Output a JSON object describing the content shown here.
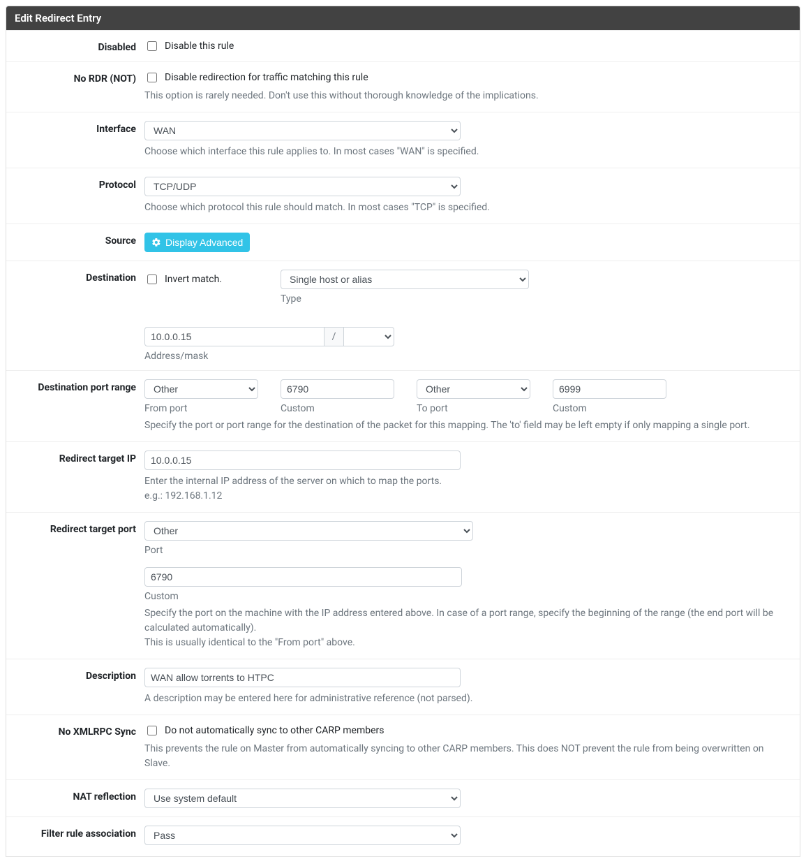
{
  "panel": {
    "title": "Edit Redirect Entry"
  },
  "disabled": {
    "label": "Disabled",
    "checkbox_label": "Disable this rule"
  },
  "nordr": {
    "label": "No RDR (NOT)",
    "checkbox_label": "Disable redirection for traffic matching this rule",
    "help": "This option is rarely needed. Don't use this without thorough knowledge of the implications."
  },
  "interface": {
    "label": "Interface",
    "value": "WAN",
    "help": "Choose which interface this rule applies to. In most cases \"WAN\" is specified."
  },
  "protocol": {
    "label": "Protocol",
    "value": "TCP/UDP",
    "help": "Choose which protocol this rule should match. In most cases \"TCP\" is specified."
  },
  "source": {
    "label": "Source",
    "button": "Display Advanced"
  },
  "destination": {
    "label": "Destination",
    "invert_label": "Invert match.",
    "type_value": "Single host or alias",
    "type_label": "Type",
    "address_value": "10.0.0.15",
    "mask_value": "",
    "slash": "/",
    "address_label": "Address/mask"
  },
  "dport": {
    "label": "Destination port range",
    "from_value": "Other",
    "from_label": "From port",
    "from_custom_value": "6790",
    "from_custom_label": "Custom",
    "to_value": "Other",
    "to_label": "To port",
    "to_custom_value": "6999",
    "to_custom_label": "Custom",
    "help": "Specify the port or port range for the destination of the packet for this mapping. The 'to' field may be left empty if only mapping a single port."
  },
  "rtip": {
    "label": "Redirect target IP",
    "value": "10.0.0.15",
    "help1": "Enter the internal IP address of the server on which to map the ports.",
    "help2": "e.g.: 192.168.1.12"
  },
  "rtport": {
    "label": "Redirect target port",
    "port_value": "Other",
    "port_label": "Port",
    "custom_value": "6790",
    "custom_label": "Custom",
    "help1": "Specify the port on the machine with the IP address entered above. In case of a port range, specify the beginning of the range (the end port will be calculated automatically).",
    "help2": "This is usually identical to the \"From port\" above."
  },
  "description": {
    "label": "Description",
    "value": "WAN allow torrents to HTPC",
    "help": "A description may be entered here for administrative reference (not parsed)."
  },
  "noxmlrpc": {
    "label": "No XMLRPC Sync",
    "checkbox_label": "Do not automatically sync to other CARP members",
    "help": "This prevents the rule on Master from automatically syncing to other CARP members. This does NOT prevent the rule from being overwritten on Slave."
  },
  "natrefl": {
    "label": "NAT reflection",
    "value": "Use system default"
  },
  "filterassoc": {
    "label": "Filter rule association",
    "value": "Pass"
  }
}
